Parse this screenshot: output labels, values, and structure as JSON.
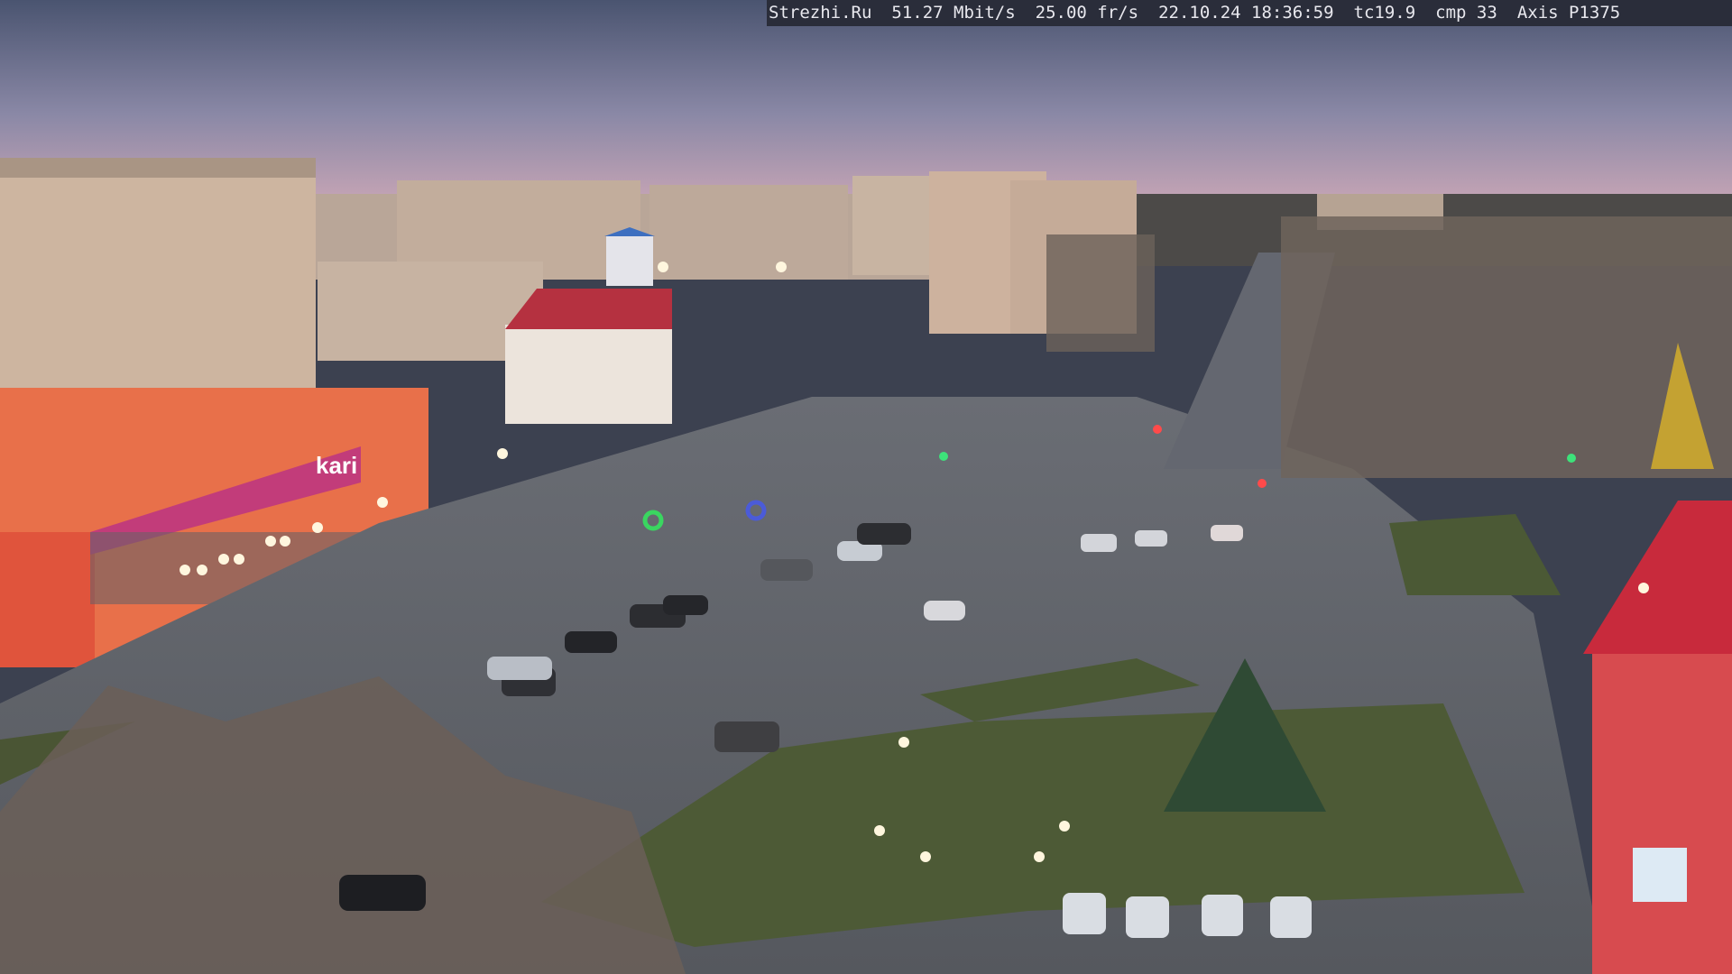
{
  "camera_overlay": {
    "site": "Strezhi.Ru",
    "bitrate": "51.27 Mbit/s",
    "framerate": "25.00 fr/s",
    "timestamp": "22.10.24 18:36:59",
    "tc": "tc19.9",
    "cmp": "cmp 33",
    "camera_model": "Axis P1375"
  },
  "signage": {
    "store_name": "kari"
  },
  "colors": {
    "sky_top": "#5b6582",
    "sky_bottom": "#c9a6b6",
    "road": "#5a5d63",
    "grass": "#4d5a36",
    "store_facade": "#e8704a",
    "store_sign": "#c23c7a",
    "red_roof": "#c82a3c"
  }
}
